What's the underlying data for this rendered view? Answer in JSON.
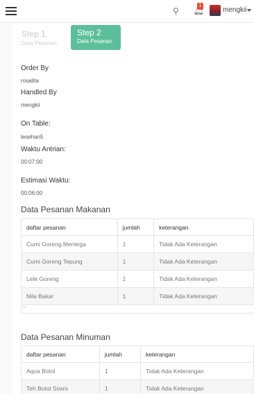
{
  "topbar": {
    "menu_icon": "hamburger-icon",
    "bulb_icon": "lightbulb-icon",
    "bell_icon": "bell-icon",
    "notif_count": "1",
    "username": "mengkii",
    "caret_icon": "caret-down-icon"
  },
  "steps": [
    {
      "title": "Step 1",
      "sub": "Data Pesanan"
    },
    {
      "title": "Step 2",
      "sub": "Data Pesanan"
    }
  ],
  "info": {
    "order_by_label": "Order By",
    "order_by_value": "rosalita",
    "handled_by_label": "Handled By",
    "handled_by_value": "mengkii",
    "table_label": "On Table:",
    "table_value": "lesehan5",
    "queue_label": "Waktu Antrian:",
    "queue_value": "00:07:00",
    "estimate_label": "Estimasi Waktu:",
    "estimate_value": "00:06:00"
  },
  "food": {
    "title": "Data Pesanan Makanan",
    "headers": [
      "daftar pesanan",
      "jumlah",
      "keterangan"
    ],
    "rows": [
      [
        "Cumi Goreng Mentega",
        "1",
        "Tidak Ada Keterangan"
      ],
      [
        "Cumi Goreng Tepung",
        "1",
        "Tidak Ada Keterangan"
      ],
      [
        "Lele Goreng",
        "1",
        "Tidak Ada Keterangan"
      ],
      [
        "Nila Bakar",
        "1",
        "Tidak Ada Keterangan"
      ]
    ],
    "footer_mark": "–"
  },
  "drink": {
    "title": "Data Pesanan Minuman",
    "headers": [
      "daftar pesanan",
      "jumlah",
      "keterangan"
    ],
    "rows": [
      [
        "Aqua Botol",
        "1",
        "Tidak Ada Keterangan"
      ],
      [
        "Teh Botol Sosro",
        "1",
        "Tidak Ada Keterangan"
      ]
    ]
  }
}
